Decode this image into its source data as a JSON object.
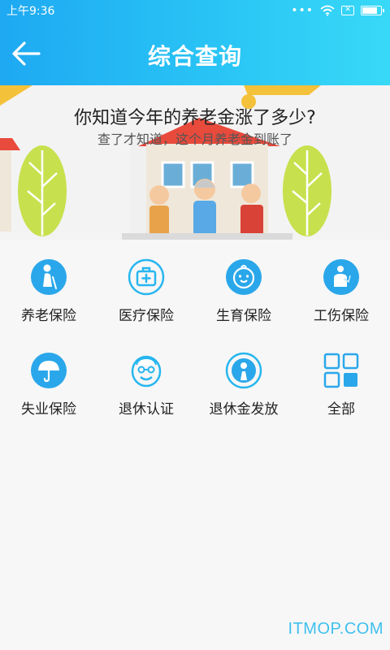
{
  "status": {
    "time": "上午9:36",
    "dots": "•••",
    "sim_label": "✕",
    "battery_level": 0.9
  },
  "header": {
    "title": "综合查询",
    "back_icon": "arrow-left-icon"
  },
  "banner": {
    "headline": "你知道今年的养老金涨了多少?",
    "subline": "查了才知道，这个月养老金到账了"
  },
  "colors": {
    "header_gradient": [
      "#1ea9f2",
      "#38d9f7"
    ],
    "icon_blue": "#2aa7ea",
    "icon_outline": "#27b6ef"
  },
  "services": [
    {
      "label": "养老保险",
      "icon": "elderly-person-icon"
    },
    {
      "label": "医疗保险",
      "icon": "medical-kit-icon"
    },
    {
      "label": "生育保险",
      "icon": "baby-face-icon"
    },
    {
      "label": "工伤保险",
      "icon": "injured-worker-icon"
    },
    {
      "label": "失业保险",
      "icon": "umbrella-icon"
    },
    {
      "label": "退休认证",
      "icon": "old-man-face-icon"
    },
    {
      "label": "退休金发放",
      "icon": "money-payout-icon"
    },
    {
      "label": "全部",
      "icon": "grid-all-icon"
    }
  ],
  "watermark": "ITMOP.COM"
}
